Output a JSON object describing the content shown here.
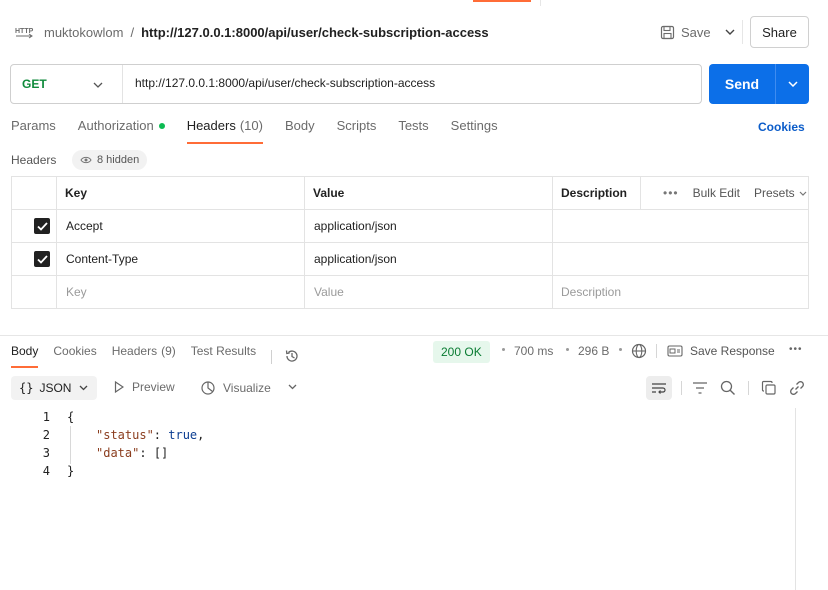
{
  "header": {
    "workspace": "muktokowlom",
    "separator": "/",
    "title": "http://127.0.0.1:8000/api/user/check-subscription-access",
    "save_label": "Save",
    "share_label": "Share"
  },
  "request": {
    "method": "GET",
    "url": "http://127.0.0.1:8000/api/user/check-subscription-access",
    "send_label": "Send"
  },
  "request_tabs": [
    {
      "label": "Params"
    },
    {
      "label": "Authorization"
    },
    {
      "label": "Headers",
      "count": "(10)"
    },
    {
      "label": "Body"
    },
    {
      "label": "Scripts"
    },
    {
      "label": "Tests"
    },
    {
      "label": "Settings"
    }
  ],
  "cookies_link": "Cookies",
  "headers_section": {
    "label": "Headers",
    "hidden": "8 hidden",
    "columns": {
      "key": "Key",
      "value": "Value",
      "description": "Description"
    },
    "bulk_edit": "Bulk Edit",
    "presets": "Presets",
    "rows": [
      {
        "key": "Accept",
        "value": "application/json",
        "checked": true
      },
      {
        "key": "Content-Type",
        "value": "application/json",
        "checked": true
      }
    ],
    "placeholders": {
      "key": "Key",
      "value": "Value",
      "description": "Description"
    }
  },
  "response_tabs": [
    {
      "label": "Body"
    },
    {
      "label": "Cookies"
    },
    {
      "label": "Headers",
      "count": "(9)"
    },
    {
      "label": "Test Results"
    }
  ],
  "response_meta": {
    "status": "200 OK",
    "time": "700 ms",
    "size": "296 B",
    "save_response": "Save Response"
  },
  "response_toolbar": {
    "format": "JSON",
    "preview": "Preview",
    "visualize": "Visualize"
  },
  "code": {
    "line_numbers": [
      "1",
      "2",
      "3",
      "4"
    ],
    "open_brace": "{",
    "status_key": "\"status\"",
    "status_value": "true",
    "data_key": "\"data\"",
    "data_value": "[]",
    "close_brace": "}"
  },
  "colors": {
    "accent": "#ff6c37",
    "send": "#0c6fe8",
    "method_get": "#0f8a3b",
    "status_ok_bg": "#e6f7ec"
  }
}
